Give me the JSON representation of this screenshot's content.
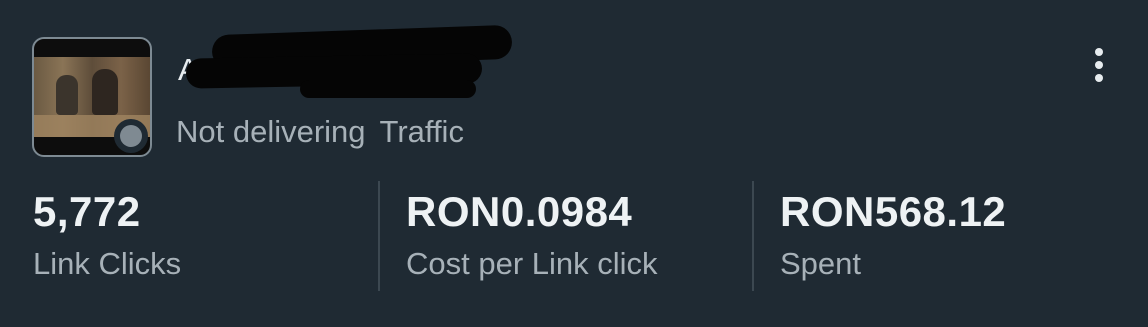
{
  "ad": {
    "name": "A...n",
    "status": "Not delivering",
    "objective": "Traffic",
    "status_color": "#7f8a92"
  },
  "menu": {
    "icon": "more-vertical-icon"
  },
  "metrics": [
    {
      "value": "5,772",
      "label": "Link Clicks"
    },
    {
      "value": "RON0.0984",
      "label": "Cost per Link click"
    },
    {
      "value": "RON568.12",
      "label": "Spent"
    }
  ],
  "colors": {
    "background": "#1f2a33",
    "primary_text": "#e7ecef",
    "secondary_text": "#a7b1b8",
    "divider": "#3c4851"
  }
}
